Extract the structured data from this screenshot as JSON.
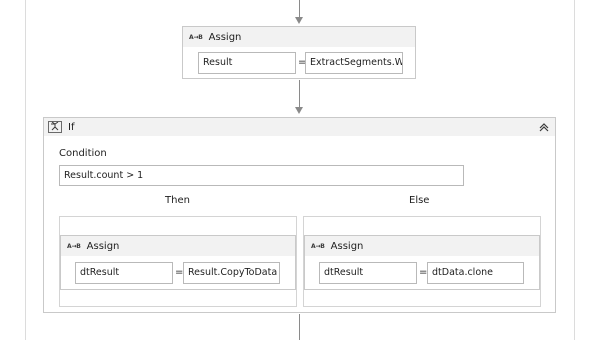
{
  "assign_top": {
    "title": "Assign",
    "icon": "A→B",
    "to_value": "Result",
    "equals": "=",
    "value_value": "ExtractSegments.W"
  },
  "if_activity": {
    "title": "If",
    "condition_label": "Condition",
    "condition_value": "Result.count > 1",
    "then_label": "Then",
    "else_label": "Else"
  },
  "assign_then": {
    "title": "Assign",
    "icon": "A→B",
    "to_value": "dtResult",
    "equals": "=",
    "value_value": "Result.CopyToData"
  },
  "assign_else": {
    "title": "Assign",
    "icon": "A→B",
    "to_value": "dtResult",
    "equals": "=",
    "value_value": "dtData.clone"
  },
  "colors": {
    "header_bg": "#f2f2f2",
    "border": "#c9c9c9",
    "connector": "#8a8a8a"
  }
}
